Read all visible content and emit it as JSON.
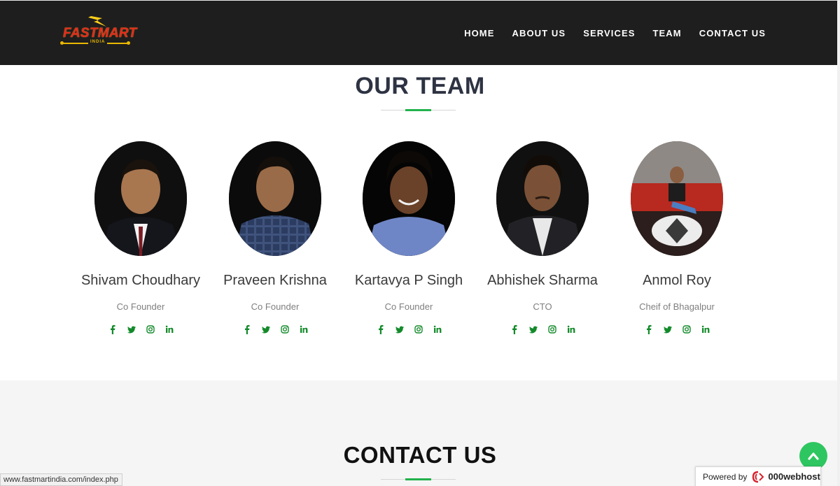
{
  "header": {
    "logo_text": "FASTMART",
    "logo_sub": "INDIA",
    "nav": [
      "HOME",
      "ABOUT US",
      "SERVICES",
      "TEAM",
      "CONTACT US"
    ]
  },
  "team": {
    "title": "OUR TEAM",
    "members": [
      {
        "name": "Shivam Choudhary",
        "role": "Co Founder"
      },
      {
        "name": "Praveen Krishna",
        "role": "Co Founder"
      },
      {
        "name": "Kartavya P Singh",
        "role": "Co Founder"
      },
      {
        "name": "Abhishek Sharma",
        "role": "CTO"
      },
      {
        "name": "Anmol Roy",
        "role": "Cheif of Bhagalpur"
      }
    ],
    "social_icons": [
      "facebook-icon",
      "twitter-icon",
      "instagram-icon",
      "linkedin-icon"
    ]
  },
  "contact": {
    "title": "CONTACT US"
  },
  "status_bar": {
    "url": "www.fastmartindia.com/index.php"
  },
  "powered_badge": {
    "label": "Powered by",
    "brand": "000webhost"
  },
  "colors": {
    "header_bg": "#1e1e1e",
    "accent_green": "#22b24c",
    "social_green": "#138a2a",
    "title_dark": "#2e3343"
  }
}
